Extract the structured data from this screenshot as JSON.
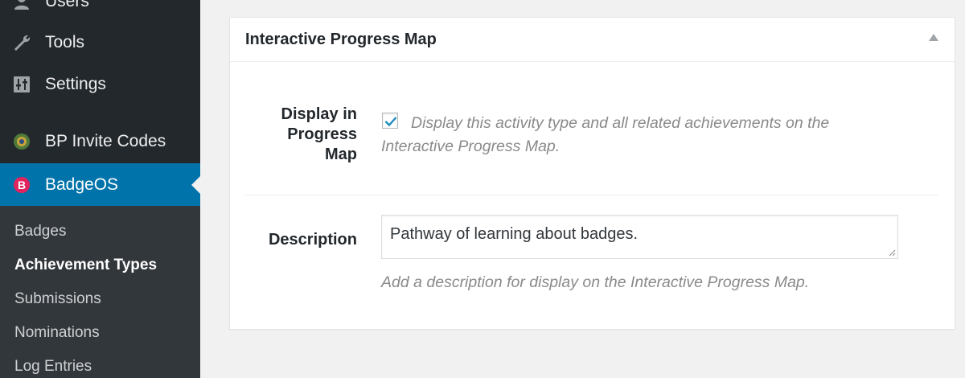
{
  "sidebar": {
    "menu": {
      "users": "Users",
      "tools": "Tools",
      "settings": "Settings",
      "bp_invite_codes": "BP Invite Codes",
      "badgeos": "BadgeOS"
    },
    "submenu": [
      "Badges",
      "Achievement Types",
      "Submissions",
      "Nominations",
      "Log Entries"
    ],
    "current_submenu": "Achievement Types",
    "colors": {
      "background": "#23282d",
      "submenu_background": "#32373c",
      "active": "#0073aa",
      "badgeos_icon": "#e0245e"
    }
  },
  "metabox": {
    "title": "Interactive Progress Map",
    "progress_map_label": "Display in Progress Map",
    "progress_map_checked": true,
    "progress_map_help": "Display this activity type and all related achievements on the Interactive Progress Map.",
    "description_label": "Description",
    "description_value": "Pathway of learning about badges.",
    "description_help": "Add a description for display on the Interactive Progress Map."
  }
}
